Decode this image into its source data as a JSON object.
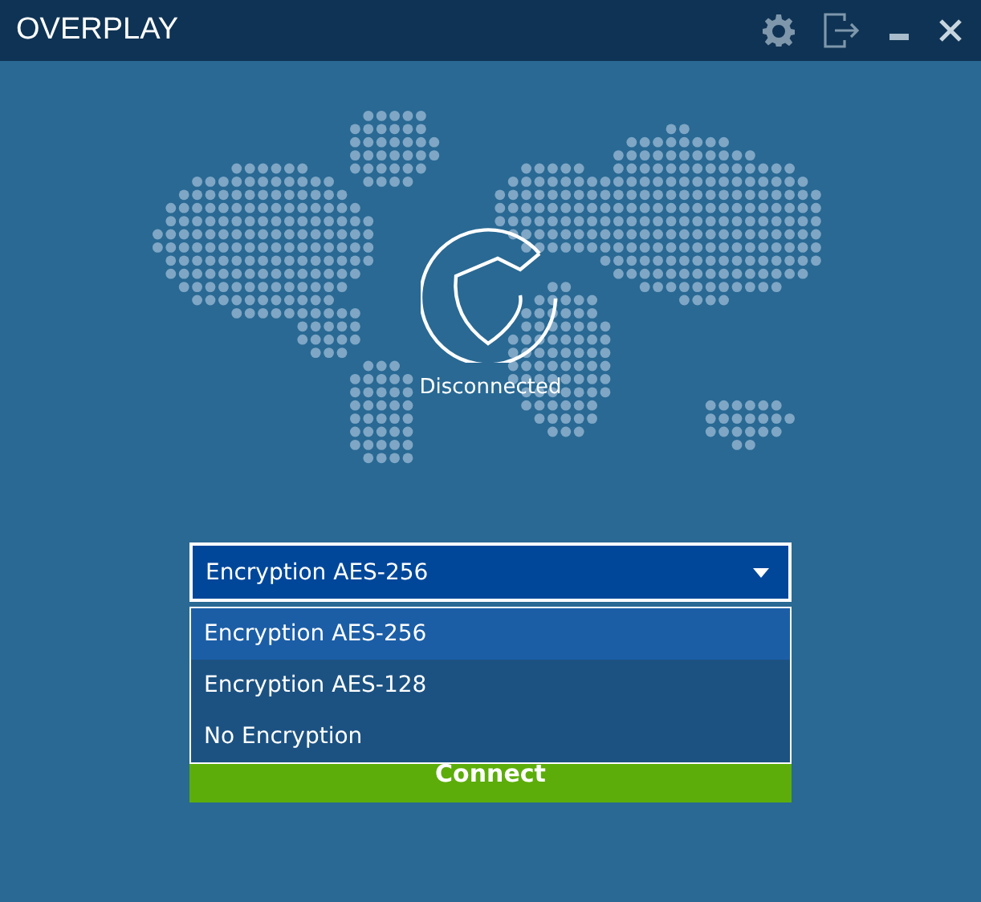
{
  "window": {
    "title": "OVERPLAY"
  },
  "status": "Disconnected",
  "encryption": {
    "value": "Encryption AES-256",
    "expanded": true,
    "options": [
      {
        "label": "Encryption AES-256",
        "selected": true
      },
      {
        "label": "Encryption AES-128",
        "selected": false
      },
      {
        "label": "No Encryption",
        "selected": false
      }
    ]
  },
  "connect_button": "Connect"
}
